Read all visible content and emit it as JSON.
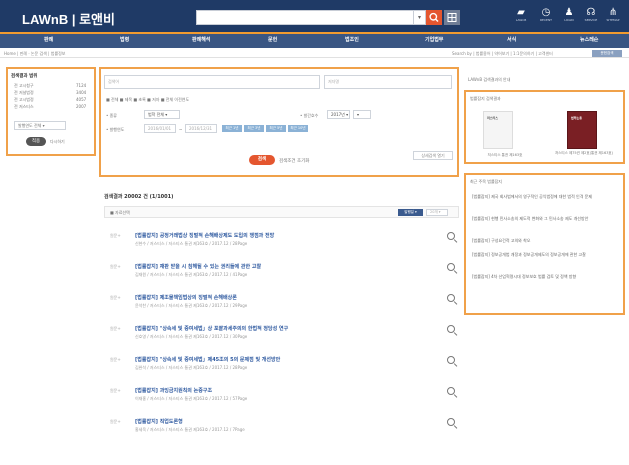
{
  "header": {
    "logo": "LAWnB | 로앤비",
    "icons": [
      {
        "name": "folder-icon",
        "label": "LAWnB"
      },
      {
        "name": "history-icon",
        "label": "RECENT"
      },
      {
        "name": "user-icon",
        "label": "LOGIN"
      },
      {
        "name": "headset-icon",
        "label": "SERVICE"
      },
      {
        "name": "sitemap-icon",
        "label": "SITEMAP"
      }
    ]
  },
  "nav": {
    "items": [
      "판례",
      "법령",
      "판례해석",
      "문헌",
      "법조인",
      "기업법무",
      "서식",
      "뉴스레슨"
    ]
  },
  "breadcrumb": "Home | 판례 · 논문 검색 | 법률정보",
  "utils": "Search by | 법률용어 | 약어보기 | 1:1문의하기 | 고객센터",
  "util_button": "문헌검색",
  "left_panel": {
    "title": "검색결과 범위",
    "items": [
      {
        "label": "전 고시청구",
        "count": "7124"
      },
      {
        "label": "전 저널법정",
        "count": "3404"
      },
      {
        "label": "전 고시법정",
        "count": "4057"
      },
      {
        "label": "전 저스티스",
        "count": "2007"
      }
    ],
    "select": "발행연도 전체 ▾",
    "apply": "적용",
    "reset": "다시하기"
  },
  "search": {
    "keyword_placeholder": "검색어",
    "author_placeholder": "저자명",
    "options": "■ 전체  ■ 제목  ■ 초록  ■ 저자  ■ 전체 이전연도",
    "type_label": "• 종류",
    "type_value": "법학 전체 ▾",
    "year_label": "• 발간호수",
    "year_value": "2017년 ▾",
    "period_label": "• 발행연도",
    "from_date": "2016/01/01",
    "to_date": "2016/12/31",
    "chips": [
      "최근 1년",
      "최근 3년",
      "최근 5년",
      "최근 10년"
    ],
    "search_button": "검색",
    "reset_button": "검색조건 초기화",
    "detail_button": "상세검색 열기"
  },
  "results": {
    "summary": "검색결과 20002 건 (1/1001)",
    "select_all": "■ 자료선택",
    "sort": "발행일 ▾",
    "per_page": "20개 ▾",
    "items": [
      {
        "title": "[법률잡지] 공정거래법상 징벌적 손해배상제도 도입의 쟁점과 전망",
        "meta": "신현수 / 저스티스 / 저스티스 통권 제163호 / 2017.12 / 28Page"
      },
      {
        "title": "[법률잡지] 재판 받을 시 침해될 수 있는 권리들에 관한 고찰",
        "meta": "김재원 / 저스티스 / 저스티스 통권 제163호 / 2017.12 / 41Page"
      },
      {
        "title": "[법률잡지] 제조물책임법상의 징벌적 손해배상론",
        "meta": "윤석찬 / 저스티스 / 저스티스 통권 제163호 / 2017.12 / 29Page"
      },
      {
        "title": "[법률잡지] \"상속세 및 증여세법」상 포괄과세주의의 한법적 정당성 연구",
        "meta": "신호영 / 저스티스 / 저스티스 통권 제163호 / 2017.12 / 30Page"
      },
      {
        "title": "[법률잡지] \"상속세 및 증여세법」제45조의 5의 문제점 및 개선방안",
        "meta": "김완석 / 저스티스 / 저스티스 통권 제163호 / 2017.12 / 28Page"
      },
      {
        "title": "[법률잡지] 과잉금지원칙의 논증구조",
        "meta": "이재홍 / 저스티스 / 저스티스 통권 제163호 / 2017.12 / 57Page"
      },
      {
        "title": "[법률잡지] 직업도론형",
        "meta": "홍세욱 / 저스티스 / 저스티스 통권 제163호 / 2017.12 / 7Page"
      }
    ],
    "badge": "원문+"
  },
  "right_panel": {
    "title": "LAWnB 검색결과의 안내",
    "journals_title": "법률잡지 검색결과",
    "journals": [
      {
        "name": "저스티스 통권 제163호",
        "cover": "저스티스"
      },
      {
        "name": "저스티스 제75권 제2호(통권 제163호)",
        "cover": "법학논총"
      }
    ],
    "recent_title": "최근 주목 법률잡지",
    "recent": [
      "[법률잡지] 제국 회사법에서의 영구적인 공익법정에 대한 법적 인격 문제",
      "[법률잡지] 현행 민사소송의 제도적 변화와 그 민사소송 제도 개선방안",
      "[법률잡지] 구성요건적 고의와 착오",
      "[법률잡지] 정보공개법 개정과 정보공개제도의 정보공개에 관한 고찰",
      "[법률잡지] 4차 산업혁명시대 정보보호 법률 검토 및 정책 방향"
    ]
  },
  "colors": {
    "header": "#1f3a66",
    "nav": "#3a5683",
    "accent": "#e4562f",
    "highlight_border": "#f0a14a",
    "link": "#2f5aa0"
  }
}
